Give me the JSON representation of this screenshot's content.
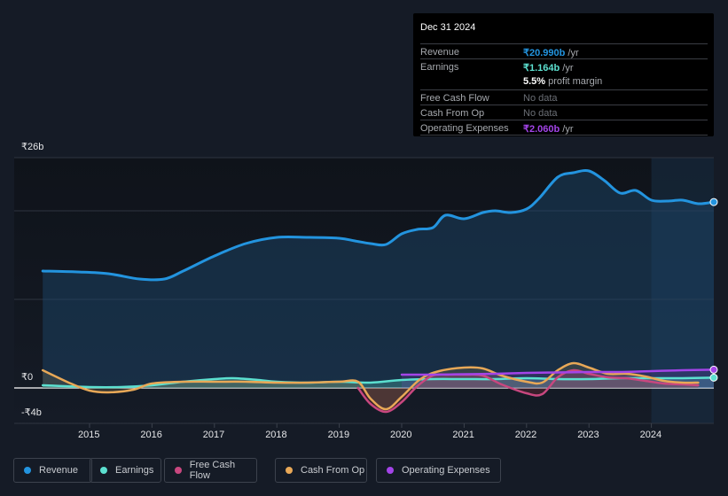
{
  "tooltip": {
    "date": "Dec 31 2024",
    "rows": [
      {
        "label": "Revenue",
        "value": "₹20.990b",
        "suffix": " /yr",
        "color": "#2394df"
      },
      {
        "label": "Earnings",
        "value": "₹1.164b",
        "suffix": " /yr",
        "color": "#5ce0d0"
      },
      {
        "label": "",
        "value": "5.5%",
        "suffix": " profit margin",
        "color": "#ffffff"
      },
      {
        "label": "Free Cash Flow",
        "value": "",
        "suffix": "No data",
        "color": "#6b6f76"
      },
      {
        "label": "Cash From Op",
        "value": "",
        "suffix": "No data",
        "color": "#6b6f76"
      },
      {
        "label": "Operating Expenses",
        "value": "₹2.060b",
        "suffix": " /yr",
        "color": "#a344e8"
      }
    ]
  },
  "legend": [
    {
      "label": "Revenue",
      "color": "#2394df"
    },
    {
      "label": "Earnings",
      "color": "#5ce0d0"
    },
    {
      "label": "Free Cash Flow",
      "color": "#c8477f"
    },
    {
      "label": "Cash From Op",
      "color": "#e8a857"
    },
    {
      "label": "Operating Expenses",
      "color": "#a344e8"
    }
  ],
  "chart_data": {
    "type": "line",
    "title": "",
    "xlabel": "",
    "ylabel": "",
    "currency": "₹",
    "unit": "b",
    "ylim": [
      -4,
      26
    ],
    "y_tick_labels": [
      "₹26b",
      "₹0",
      "-₹4b"
    ],
    "y_ticks": [
      26,
      0,
      -4
    ],
    "gridlines": [
      26,
      20,
      10,
      0
    ],
    "x_tick_labels": [
      "2015",
      "2016",
      "2017",
      "2018",
      "2019",
      "2020",
      "2021",
      "2022",
      "2023",
      "2024"
    ],
    "x_ticks": [
      2015,
      2016,
      2017,
      2018,
      2019,
      2020,
      2021,
      2022,
      2023,
      2024
    ],
    "xlim": [
      2013.7,
      2025.0
    ],
    "forecast_shade_start": 2024.0,
    "series": [
      {
        "name": "Revenue",
        "color": "#2394df",
        "fill": true,
        "x": [
          2014.25,
          2014.8,
          2015.3,
          2015.8,
          2016.2,
          2016.5,
          2017.0,
          2017.5,
          2018.0,
          2018.5,
          2019.0,
          2019.25,
          2019.5,
          2019.75,
          2020.0,
          2020.25,
          2020.5,
          2020.7,
          2021.0,
          2021.3,
          2021.5,
          2021.75,
          2022.0,
          2022.2,
          2022.5,
          2022.75,
          2023.0,
          2023.25,
          2023.5,
          2023.75,
          2024.0,
          2024.25,
          2024.5,
          2024.75,
          2025.0
        ],
        "values": [
          13.2,
          13.1,
          12.9,
          12.3,
          12.3,
          13.2,
          14.9,
          16.3,
          17.0,
          17.0,
          16.9,
          16.6,
          16.3,
          16.2,
          17.4,
          17.9,
          18.1,
          19.5,
          19.1,
          19.8,
          20.0,
          19.8,
          20.2,
          21.4,
          23.8,
          24.3,
          24.5,
          23.4,
          22.0,
          22.3,
          21.2,
          21.1,
          21.2,
          20.8,
          20.99
        ]
      },
      {
        "name": "Earnings",
        "color": "#5ce0d0",
        "fill": true,
        "x": [
          2014.25,
          2015.0,
          2015.5,
          2016.0,
          2016.5,
          2017.0,
          2017.3,
          2017.7,
          2018.0,
          2018.5,
          2019.0,
          2019.5,
          2020.0,
          2020.5,
          2021.0,
          2021.5,
          2022.0,
          2022.5,
          2023.0,
          2023.5,
          2024.0,
          2024.5,
          2025.0
        ],
        "values": [
          0.3,
          0.1,
          0.1,
          0.3,
          0.7,
          1.0,
          1.1,
          0.9,
          0.7,
          0.6,
          0.7,
          0.6,
          0.9,
          1.0,
          1.0,
          1.0,
          1.1,
          1.0,
          1.0,
          1.1,
          1.1,
          1.1,
          1.164
        ]
      },
      {
        "name": "Free Cash Flow",
        "color": "#c8477f",
        "fill": true,
        "x": [
          2019.3,
          2019.5,
          2019.75,
          2020.0,
          2020.25,
          2020.5,
          2020.75,
          2021.0,
          2021.3,
          2021.6,
          2022.0,
          2022.25,
          2022.5,
          2022.75,
          2023.0,
          2023.3,
          2023.6,
          2023.9,
          2024.2,
          2024.5,
          2024.75
        ],
        "values": [
          0.0,
          -1.8,
          -2.7,
          -1.6,
          0.2,
          1.4,
          1.5,
          1.5,
          1.4,
          0.4,
          -0.6,
          -0.7,
          1.2,
          2.0,
          1.6,
          1.2,
          1.1,
          0.8,
          0.5,
          0.4,
          0.3
        ]
      },
      {
        "name": "Cash From Op",
        "color": "#e8a857",
        "fill": true,
        "x": [
          2014.25,
          2014.7,
          2015.0,
          2015.3,
          2015.7,
          2016.0,
          2016.5,
          2017.0,
          2017.5,
          2018.0,
          2018.5,
          2019.0,
          2019.3,
          2019.5,
          2019.75,
          2020.0,
          2020.3,
          2020.6,
          2021.0,
          2021.3,
          2021.6,
          2022.0,
          2022.25,
          2022.5,
          2022.75,
          2023.0,
          2023.3,
          2023.6,
          2023.9,
          2024.2,
          2024.5,
          2024.75
        ],
        "values": [
          2.0,
          0.5,
          -0.3,
          -0.5,
          -0.2,
          0.5,
          0.7,
          0.7,
          0.7,
          0.6,
          0.6,
          0.7,
          0.7,
          -1.2,
          -2.4,
          -1.0,
          1.0,
          1.9,
          2.3,
          2.2,
          1.4,
          0.7,
          0.6,
          2.0,
          2.8,
          2.3,
          1.6,
          1.6,
          1.3,
          0.8,
          0.6,
          0.6
        ]
      },
      {
        "name": "Operating Expenses",
        "color": "#a344e8",
        "fill": true,
        "x": [
          2020.0,
          2020.5,
          2021.0,
          2021.5,
          2022.0,
          2022.5,
          2023.0,
          2023.5,
          2024.0,
          2024.5,
          2025.0
        ],
        "values": [
          1.5,
          1.5,
          1.55,
          1.6,
          1.7,
          1.75,
          1.8,
          1.8,
          1.9,
          2.0,
          2.06
        ]
      }
    ]
  }
}
